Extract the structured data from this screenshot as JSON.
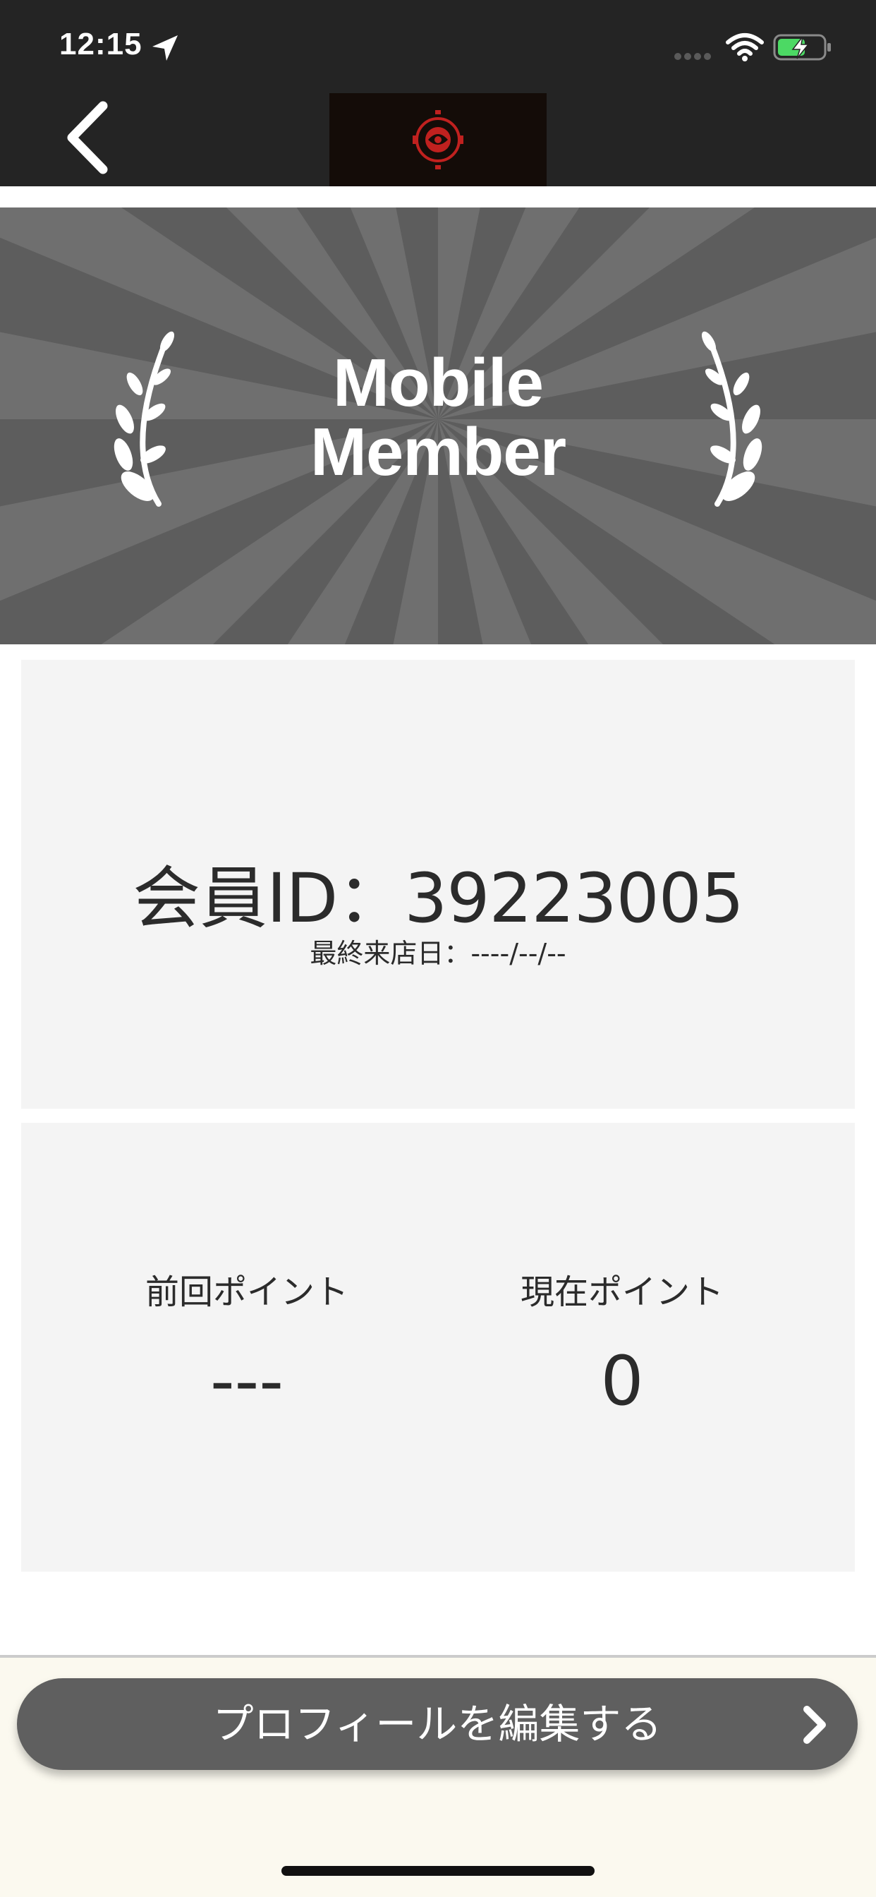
{
  "status_bar": {
    "time": "12:15",
    "location_icon": "location-arrow-icon",
    "signal_icon": "cell-signal-icon",
    "wifi_icon": "wifi-icon",
    "battery_icon": "battery-charging-icon"
  },
  "nav": {
    "back_icon": "chevron-left-icon",
    "logo": "restaurant-logo"
  },
  "banner": {
    "line1": "Mobile",
    "line2": "Member",
    "decoration_icon": "laurel-icon"
  },
  "member_card": {
    "member_id": "会員ID：39223005",
    "last_visit": "最終来店日：----/--/--"
  },
  "points_card": {
    "previous_label": "前回ポイント",
    "previous_value": "---",
    "current_label": "現在ポイント",
    "current_value": "0"
  },
  "footer": {
    "edit_profile_label": "プロフィールを編集する",
    "edit_chevron_icon": "chevron-right-icon"
  },
  "colors": {
    "topbar": "#242424",
    "banner": "#5d5d5d",
    "card": "#f4f4f4",
    "button": "#5f5f5f",
    "logo_accent": "#c0211f"
  }
}
